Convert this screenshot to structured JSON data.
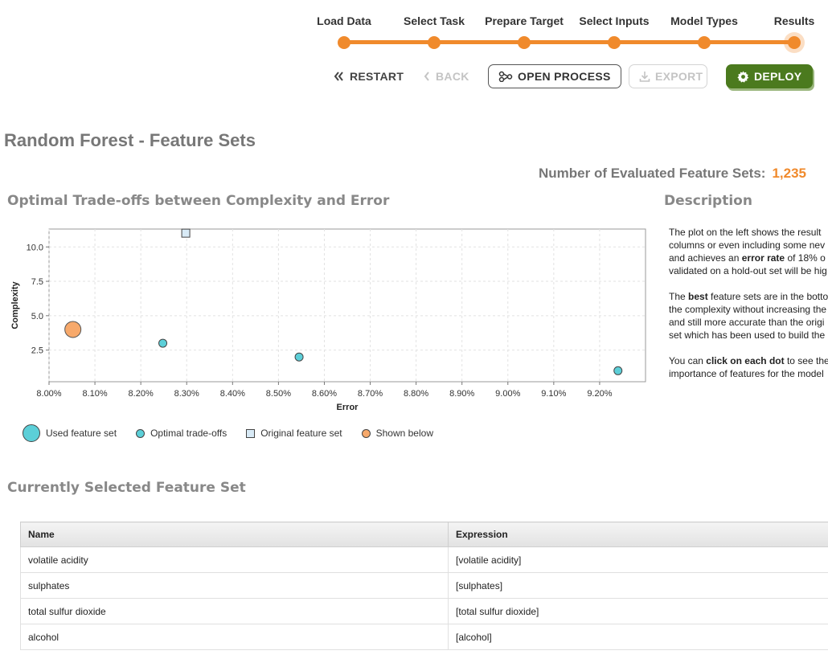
{
  "wizard": {
    "steps": [
      {
        "label": "Load Data"
      },
      {
        "label": "Select Task"
      },
      {
        "label": "Prepare Target"
      },
      {
        "label": "Select Inputs"
      },
      {
        "label": "Model Types"
      },
      {
        "label": "Results"
      }
    ],
    "active_step": "Results",
    "accent_color": "#f08a2c"
  },
  "actions": {
    "restart_label": "RESTART",
    "back_label": "BACK",
    "open_process_label": "OPEN PROCESS",
    "export_label": "EXPORT",
    "deploy_label": "DEPLOY",
    "deploy_color": "#4b7a1e"
  },
  "page": {
    "title": "Random Forest - Feature Sets",
    "count_label": "Number of Evaluated Feature Sets:",
    "count_value": "1,235"
  },
  "chart_section": {
    "title": "Optimal Trade-offs between Complexity and Error"
  },
  "chart_data": {
    "type": "scatter",
    "xlabel": "Error",
    "ylabel": "Complexity",
    "xlim": [
      0.08,
      0.093
    ],
    "ylim": [
      0.2,
      11.3
    ],
    "x_ticks": [
      "8.00%",
      "8.10%",
      "8.20%",
      "8.30%",
      "8.40%",
      "8.50%",
      "8.60%",
      "8.70%",
      "8.80%",
      "8.90%",
      "9.00%",
      "9.10%",
      "9.20%"
    ],
    "x_tick_values": [
      0.08,
      0.081,
      0.082,
      0.083,
      0.084,
      0.085,
      0.086,
      0.087,
      0.088,
      0.089,
      0.09,
      0.091,
      0.092
    ],
    "y_ticks": [
      "2.5",
      "5.0",
      "7.5",
      "10.0"
    ],
    "y_tick_values": [
      2.5,
      5.0,
      7.5,
      10.0
    ],
    "grid": true,
    "points": [
      {
        "x": 0.08052,
        "y": 4.0,
        "kind": "shown"
      },
      {
        "x": 0.08248,
        "y": 3.0,
        "kind": "optimal"
      },
      {
        "x": 0.08298,
        "y": 11.0,
        "kind": "original"
      },
      {
        "x": 0.08545,
        "y": 2.0,
        "kind": "optimal"
      },
      {
        "x": 0.0924,
        "y": 1.0,
        "kind": "optimal"
      }
    ],
    "legend": [
      {
        "label": "Used feature set",
        "kind": "used"
      },
      {
        "label": "Optimal trade-offs",
        "kind": "optimal"
      },
      {
        "label": "Original feature set",
        "kind": "original"
      },
      {
        "label": "Shown below",
        "kind": "shown"
      }
    ],
    "colors": {
      "optimal": "#5ccfd8",
      "original": "#d8eaf6",
      "shown": "#f7a96b",
      "used": "#5ccfd8"
    }
  },
  "description": {
    "title": "Description",
    "p1": [
      "The plot on the left shows the result",
      "columns or even including some nev",
      "and achieves an error rate of 18% o",
      "validated on a hold-out set will be hig"
    ],
    "p2": [
      "The best feature sets are in the botto",
      "the complexity without increasing the",
      "and still more accurate than the origi",
      "set which has been used to build the"
    ],
    "p3": [
      "You can click on each dot to see the",
      "importance of features for the model"
    ]
  },
  "selected_section": {
    "title": "Currently Selected Feature Set"
  },
  "feature_table": {
    "headers": [
      "Name",
      "Expression"
    ],
    "rows": [
      [
        "volatile acidity",
        "[volatile acidity]"
      ],
      [
        "sulphates",
        "[sulphates]"
      ],
      [
        "total sulfur dioxide",
        "[total sulfur dioxide]"
      ],
      [
        "alcohol",
        "[alcohol]"
      ]
    ]
  }
}
